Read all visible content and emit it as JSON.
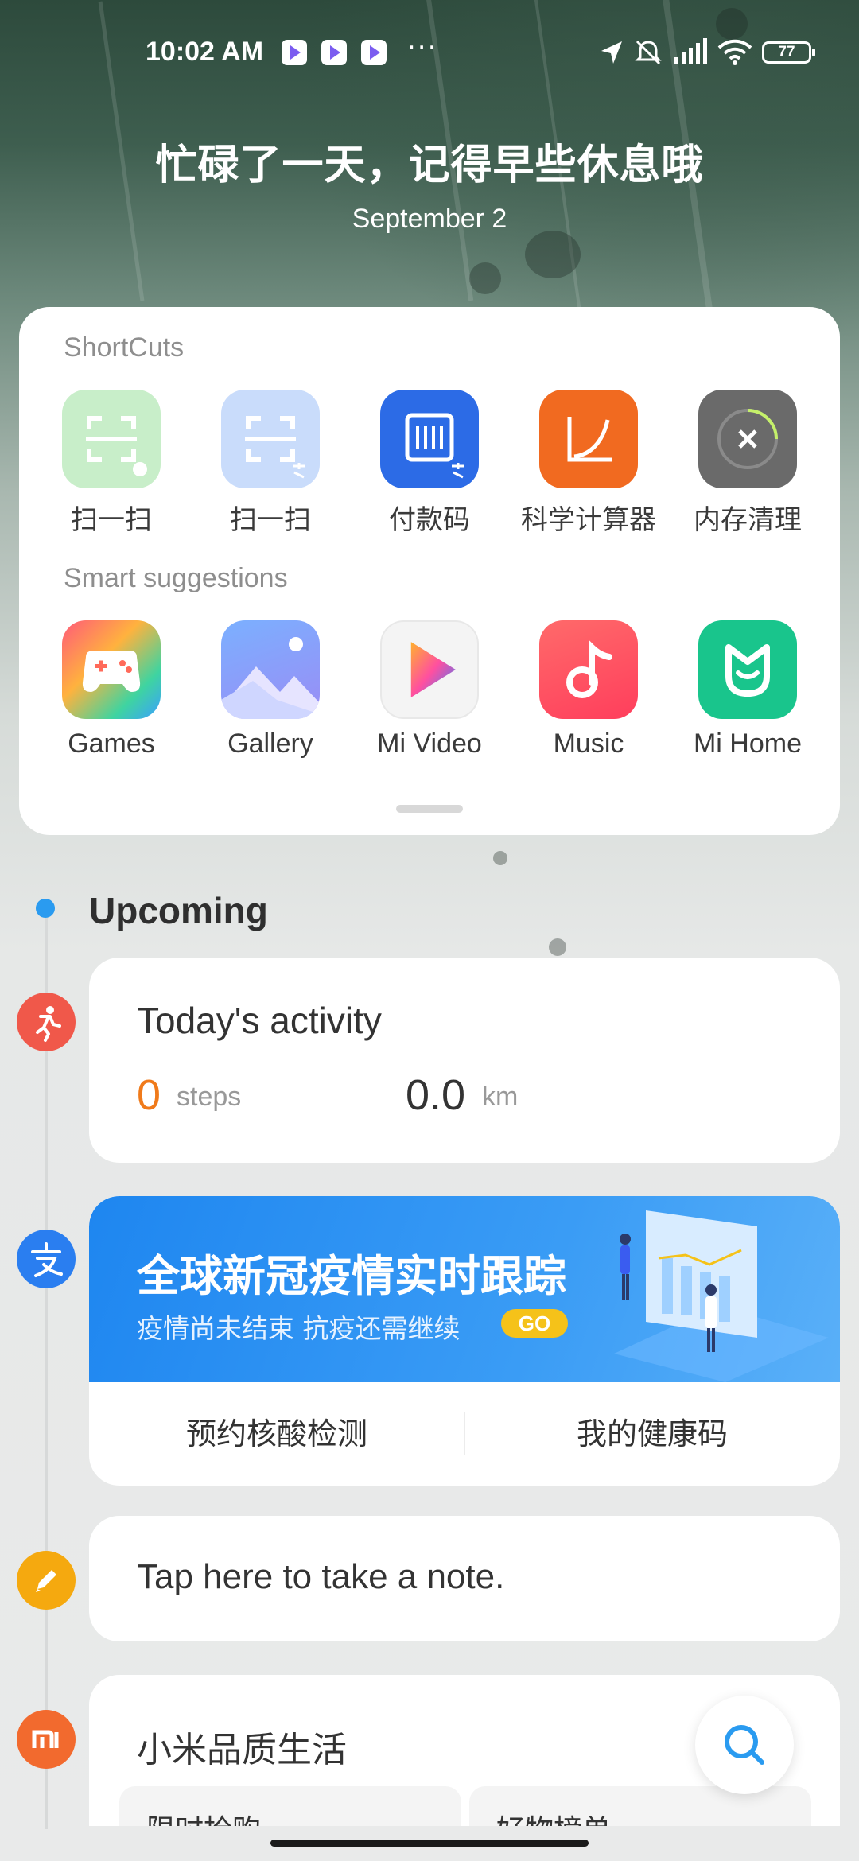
{
  "status_bar": {
    "time": "10:02 AM",
    "overflow": "···",
    "battery": "77"
  },
  "greeting": {
    "title": "忙碌了一天，记得早些休息哦",
    "date": "September 2"
  },
  "shortcuts": {
    "label": "ShortCuts",
    "items": [
      {
        "label": "扫一扫",
        "icon": "scan-wechat-icon"
      },
      {
        "label": "扫一扫",
        "icon": "scan-alipay-icon"
      },
      {
        "label": "付款码",
        "icon": "payment-code-icon"
      },
      {
        "label": "科学计算器",
        "icon": "scientific-calculator-icon"
      },
      {
        "label": "内存清理",
        "icon": "memory-cleanup-icon"
      }
    ]
  },
  "suggestions": {
    "label": "Smart suggestions",
    "items": [
      {
        "label": "Games",
        "icon": "games-icon"
      },
      {
        "label": "Gallery",
        "icon": "gallery-icon"
      },
      {
        "label": "Mi Video",
        "icon": "mi-video-icon"
      },
      {
        "label": "Music",
        "icon": "music-icon"
      },
      {
        "label": "Mi Home",
        "icon": "mi-home-icon"
      }
    ]
  },
  "upcoming": {
    "label": "Upcoming"
  },
  "activity": {
    "title": "Today's activity",
    "steps_value": "0",
    "steps_unit": "steps",
    "distance_value": "0.0",
    "distance_unit": "km"
  },
  "covid": {
    "title": "全球新冠疫情实时跟踪",
    "subtitle": "疫情尚未结束 抗疫还需继续",
    "go_label": "GO",
    "button_left": "预约核酸检测",
    "button_right": "我的健康码"
  },
  "note": {
    "placeholder": "Tap here to take a note."
  },
  "mi_life": {
    "title": "小米品质生活",
    "sub_left": "限时抢购",
    "sub_right": "好物榜单"
  },
  "colors": {
    "accent_blue": "#2a9bf0",
    "activity_orange": "#f07a1a",
    "activity_red": "#f0584a",
    "note_yellow": "#f5a90f",
    "mi_orange": "#f26a2e"
  }
}
